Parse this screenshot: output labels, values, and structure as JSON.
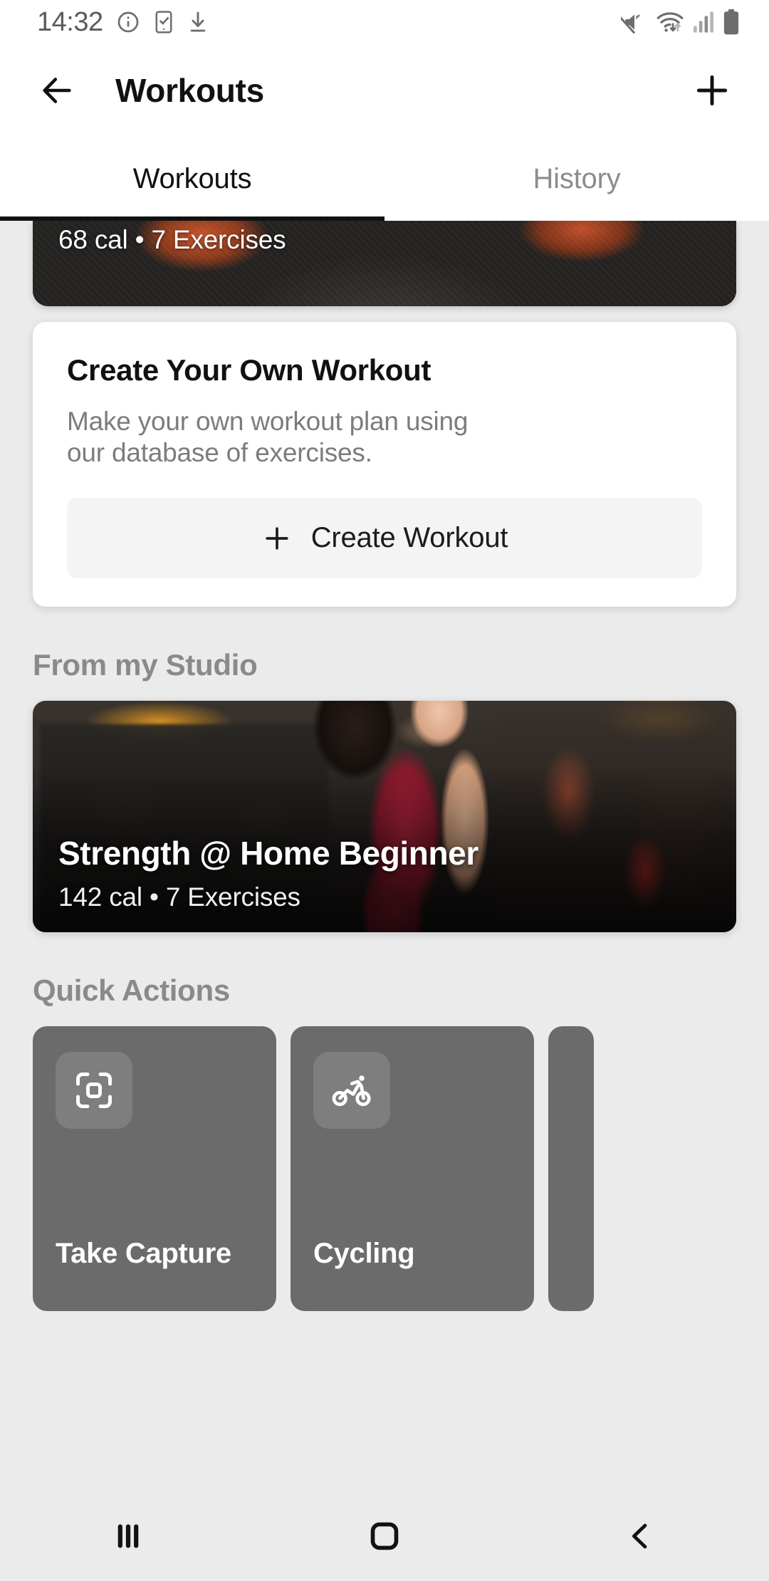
{
  "status_bar": {
    "time": "14:32",
    "left_icons": [
      "info-icon",
      "phone-check-icon",
      "download-icon"
    ],
    "right_icons": [
      "mute-icon",
      "wifi-icon",
      "signal-icon",
      "battery-icon"
    ]
  },
  "app_bar": {
    "title": "Workouts",
    "back_icon": "back-arrow-icon",
    "add_icon": "plus-icon"
  },
  "tabs": [
    {
      "label": "Workouts",
      "active": true
    },
    {
      "label": "History",
      "active": false
    }
  ],
  "peek_card": {
    "subtitle": "68 cal • 7 Exercises"
  },
  "create_card": {
    "title": "Create Your Own Workout",
    "description": "Make your own workout plan using our database of exercises.",
    "button_label": "Create Workout",
    "button_icon": "plus-icon"
  },
  "studio_section": {
    "heading": "From my Studio",
    "card": {
      "title": "Strength @ Home Beginner",
      "subtitle": "142 cal • 7 Exercises"
    }
  },
  "quick_actions": {
    "heading": "Quick Actions",
    "items": [
      {
        "label": "Take Capture",
        "icon": "scan-capture-icon"
      },
      {
        "label": "Cycling",
        "icon": "cycling-icon"
      },
      {
        "label": "",
        "icon": ""
      }
    ]
  },
  "nav_bar": {
    "recents_icon": "recents-icon",
    "home_icon": "home-icon",
    "back_icon": "back-chevron-icon"
  },
  "colors": {
    "background": "#ebebeb",
    "surface": "#ffffff",
    "text_primary": "#111111",
    "text_secondary": "#8a8a8a",
    "quick_action_bg": "#6b6b6b",
    "tab_indicator": "#111111"
  }
}
